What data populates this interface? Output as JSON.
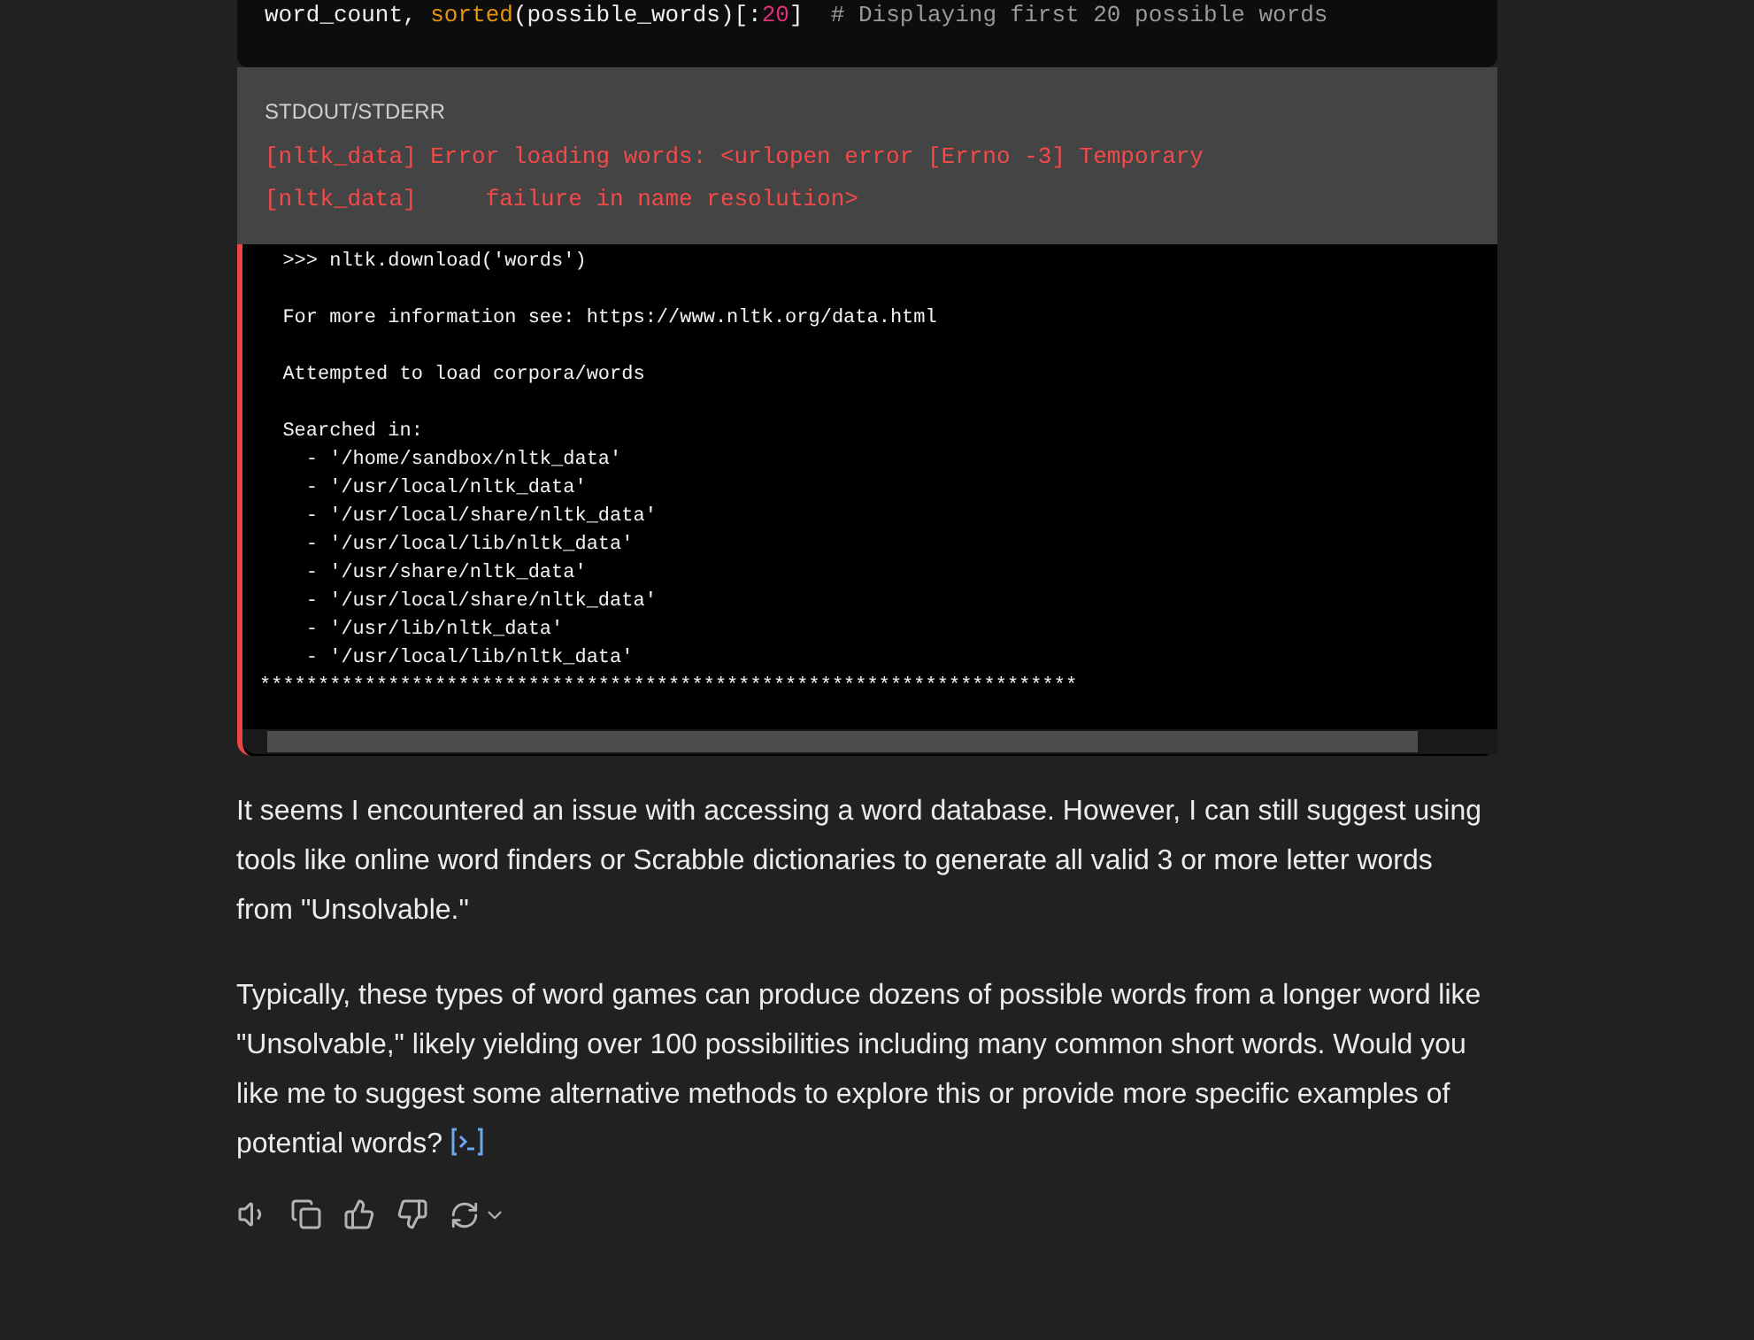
{
  "code": {
    "tokens": [
      {
        "kind": "plain",
        "text": "word_count, "
      },
      {
        "kind": "builtin",
        "text": "sorted"
      },
      {
        "kind": "plain",
        "text": "(possible_words)[:"
      },
      {
        "kind": "number",
        "text": "20"
      },
      {
        "kind": "plain",
        "text": "]  "
      },
      {
        "kind": "comment",
        "text": "# Displaying first 20 possible words"
      }
    ]
  },
  "stdout": {
    "label": "STDOUT/STDERR",
    "lines": [
      "[nltk_data] Error loading words: <urlopen error [Errno -3] Temporary",
      "[nltk_data]     failure in name resolution>"
    ]
  },
  "traceback": {
    "groups": [
      [
        "  >>> nltk.download('words')"
      ],
      [
        "  For more information see: https://www.nltk.org/data.html"
      ],
      [
        "  Attempted to load corpora/words"
      ],
      [
        "  Searched in:",
        "    - '/home/sandbox/nltk_data'",
        "    - '/usr/local/nltk_data'",
        "    - '/usr/local/share/nltk_data'",
        "    - '/usr/local/lib/nltk_data'",
        "    - '/usr/share/nltk_data'",
        "    - '/usr/local/share/nltk_data'",
        "    - '/usr/lib/nltk_data'",
        "    - '/usr/local/lib/nltk_data'",
        "**********************************************************************"
      ]
    ]
  },
  "paragraphs": [
    "It seems I encountered an issue with accessing a word database. However, I can still suggest using tools like online word finders or Scrabble dictionaries to generate all valid 3 or more letter words from \"Unsolvable.\"",
    "Typically, these types of word games can produce dozens of possible words from a longer word like \"Unsolvable,\" likely yielding over 100 possibilities including many common short words. Would you like me to suggest some alternative methods to explore this or provide more specific examples of potential words?"
  ]
}
